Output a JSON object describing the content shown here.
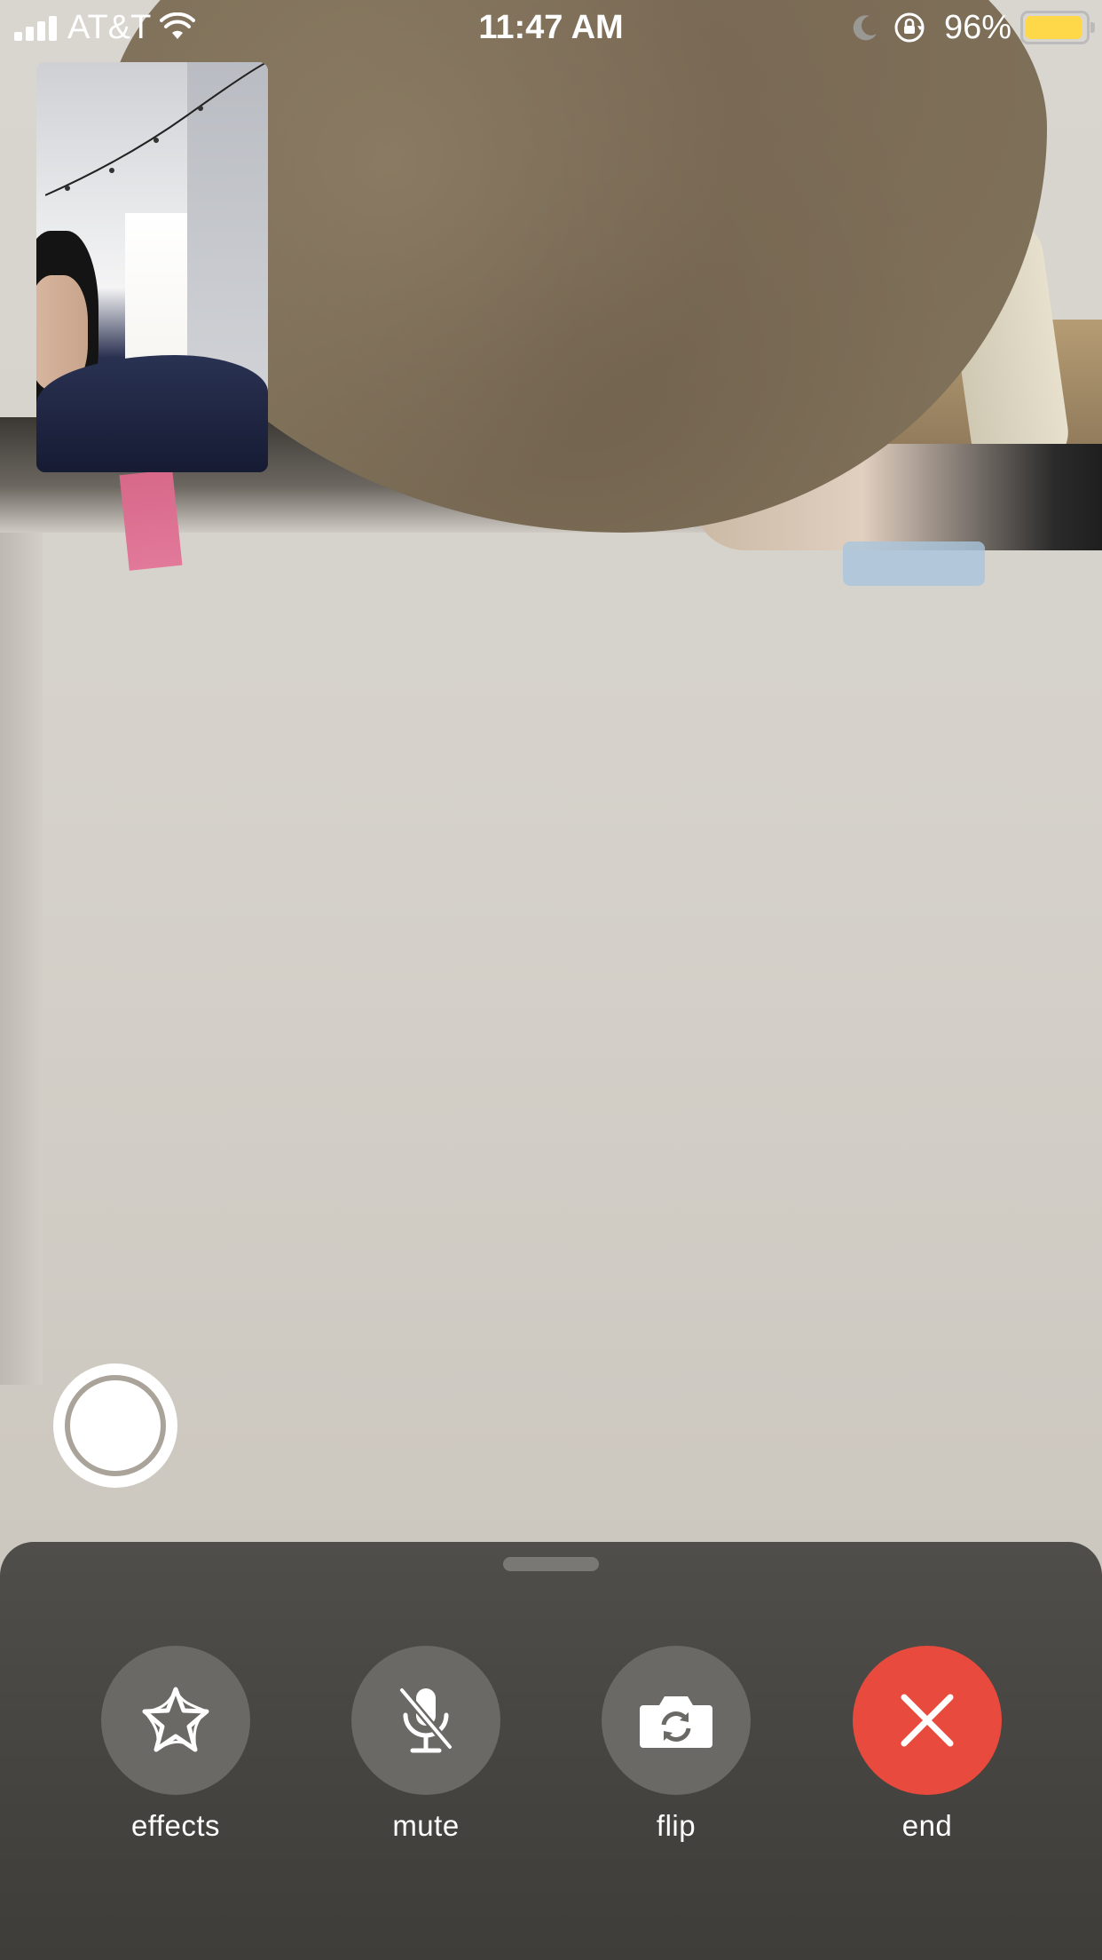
{
  "status_bar": {
    "carrier": "AT&T",
    "time": "11:47 AM",
    "battery_percent": "96%",
    "battery_level": 0.96,
    "battery_color": "#ffd84a",
    "icons": [
      "signal-icon",
      "wifi-icon",
      "moon-icon",
      "rotation-lock-icon",
      "battery-icon"
    ]
  },
  "call": {
    "controls": [
      {
        "id": "effects",
        "label": "effects",
        "icon": "star-effects-icon"
      },
      {
        "id": "mute",
        "label": "mute",
        "icon": "microphone-slash-icon"
      },
      {
        "id": "flip",
        "label": "flip",
        "icon": "camera-flip-icon"
      },
      {
        "id": "end",
        "label": "end",
        "icon": "close-x-icon",
        "color": "#e84a3d"
      }
    ]
  },
  "colors": {
    "panel": "#4a4844",
    "control_button": "#6b6965",
    "end_button": "#e84a3d",
    "text": "#ffffff"
  }
}
